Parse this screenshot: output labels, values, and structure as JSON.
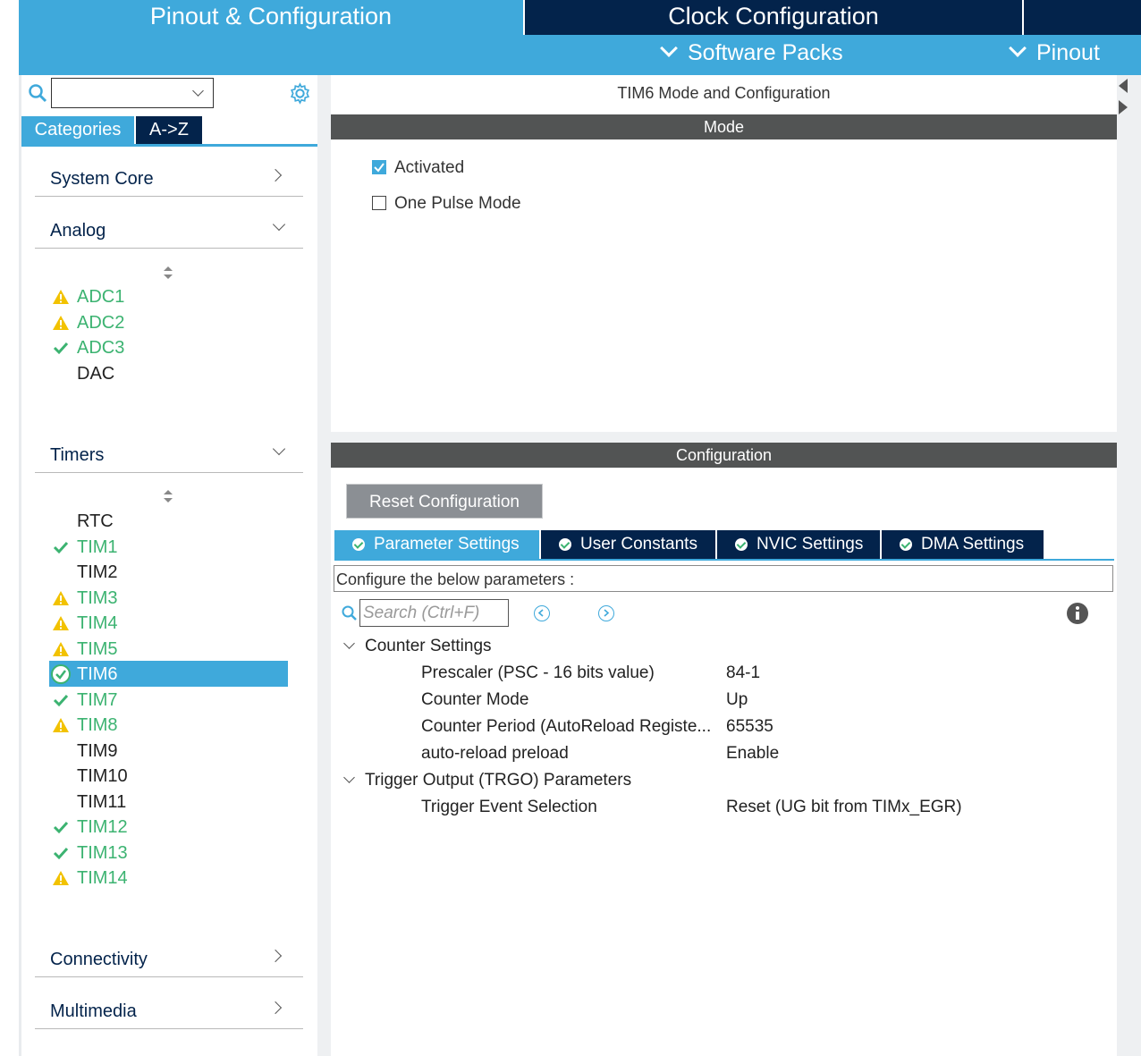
{
  "top_tabs": {
    "pinout": "Pinout & Configuration",
    "clock": "Clock Configuration"
  },
  "subbar": {
    "software_packs": "Software Packs",
    "pinout": "Pinout"
  },
  "left": {
    "search_value": "",
    "tabs": {
      "categories": "Categories",
      "az": "A->Z"
    },
    "sections": {
      "system_core": "System Core",
      "analog": "Analog",
      "timers": "Timers",
      "connectivity": "Connectivity",
      "multimedia": "Multimedia"
    },
    "analog_items": [
      {
        "label": "ADC1",
        "status": "warning"
      },
      {
        "label": "ADC2",
        "status": "warning"
      },
      {
        "label": "ADC3",
        "status": "ok"
      },
      {
        "label": "DAC",
        "status": "none"
      }
    ],
    "timer_items": [
      {
        "label": "RTC",
        "status": "none"
      },
      {
        "label": "TIM1",
        "status": "ok"
      },
      {
        "label": "TIM2",
        "status": "none"
      },
      {
        "label": "TIM3",
        "status": "warning"
      },
      {
        "label": "TIM4",
        "status": "warning"
      },
      {
        "label": "TIM5",
        "status": "warning"
      },
      {
        "label": "TIM6",
        "status": "selected"
      },
      {
        "label": "TIM7",
        "status": "ok"
      },
      {
        "label": "TIM8",
        "status": "warning"
      },
      {
        "label": "TIM9",
        "status": "none"
      },
      {
        "label": "TIM10",
        "status": "none"
      },
      {
        "label": "TIM11",
        "status": "none"
      },
      {
        "label": "TIM12",
        "status": "ok"
      },
      {
        "label": "TIM13",
        "status": "ok"
      },
      {
        "label": "TIM14",
        "status": "warning"
      }
    ]
  },
  "main": {
    "title": "TIM6 Mode and Configuration",
    "mode_header": "Mode",
    "activated_label": "Activated",
    "one_pulse_label": "One Pulse Mode",
    "config_header": "Configuration",
    "reset_button": "Reset Configuration",
    "tabs": {
      "parameter": "Parameter Settings",
      "user": "User Constants",
      "nvic": "NVIC Settings",
      "dma": "DMA Settings"
    },
    "configure_text": "Configure the below parameters :",
    "search_placeholder": "Search (Ctrl+F)",
    "groups": {
      "counter": "Counter Settings",
      "trigger": "Trigger Output (TRGO) Parameters"
    },
    "params": [
      {
        "name": "Prescaler (PSC - 16 bits value)",
        "value": "84-1"
      },
      {
        "name": "Counter Mode",
        "value": "Up"
      },
      {
        "name": "Counter Period (AutoReload Registe...",
        "value": "65535"
      },
      {
        "name": "auto-reload preload",
        "value": "Enable"
      },
      {
        "name": "Trigger Event Selection",
        "value": "Reset (UG bit from TIMx_EGR)"
      }
    ]
  },
  "colors": {
    "accent": "#3fa9db",
    "navy": "#03234b",
    "ok": "#3cb371",
    "warning": "#f2c200",
    "header_gray": "#525454"
  }
}
